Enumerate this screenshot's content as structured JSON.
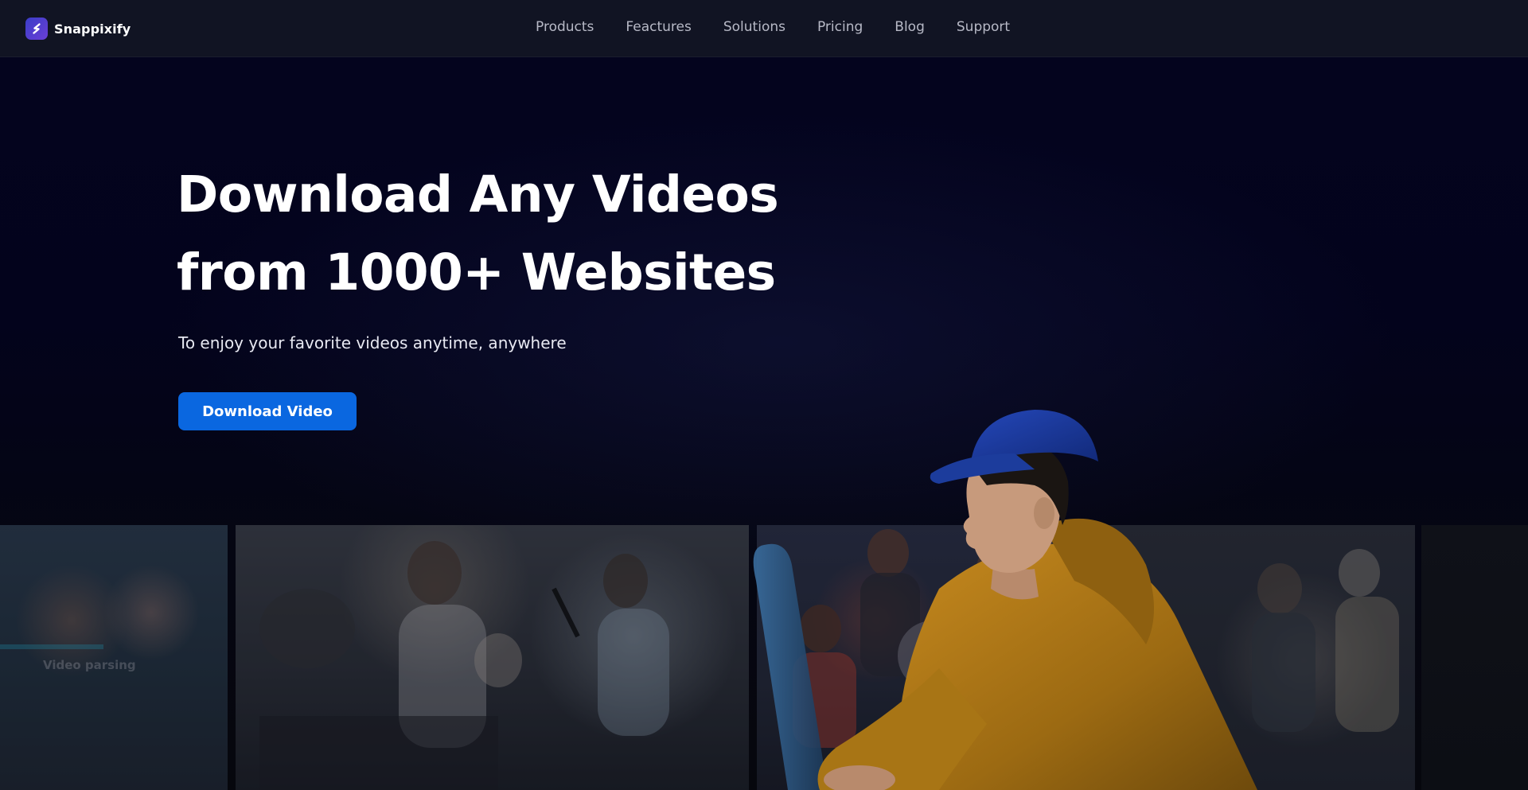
{
  "brand": {
    "name": "Snappixify",
    "logo_icon": "s-logo-icon",
    "logo_color": "#4a3fd0"
  },
  "nav": {
    "items": [
      {
        "label": "Products"
      },
      {
        "label": "Feactures"
      },
      {
        "label": "Solutions"
      },
      {
        "label": "Pricing"
      },
      {
        "label": "Blog"
      },
      {
        "label": "Support"
      }
    ]
  },
  "hero": {
    "title_line1": "Download Any Videos",
    "title_line2": "from 1000+ Websites",
    "subtitle": "To enjoy your favorite videos anytime, anywhere",
    "cta_label": "Download Video",
    "cta_color": "#0a67e0"
  },
  "media": {
    "parsing_label": "Video parsing",
    "play_icon": "play-icon"
  },
  "colors": {
    "background": "#03031a",
    "nav_background": "#111423",
    "hoodie": "#b8801c",
    "cap": "#1d3fa8"
  }
}
